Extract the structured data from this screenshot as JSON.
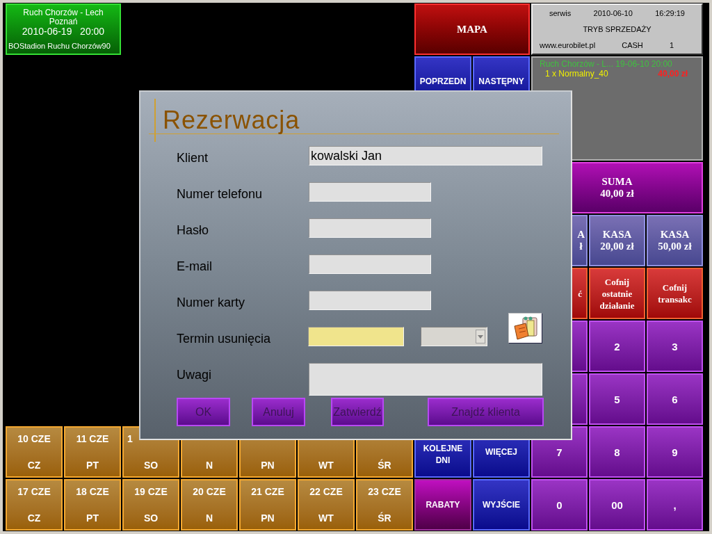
{
  "event_tile": {
    "title": "Ruch Chorzów - Lech Poznań",
    "datetime": "2010-06-19   20:00",
    "venue": "BOStadion Ruchu Chorzów",
    "count": "90"
  },
  "info_panel": {
    "user": "serwis",
    "date": "2010-06-10",
    "time": "16:29:19",
    "mode": "TRYB SPRZEDAŻY",
    "site": "www.eurobilet.pl",
    "payment": "CASH",
    "terminal": "1"
  },
  "cart": {
    "event": "Ruch Chorzów - L... 19-06-10 20:00",
    "items": [
      {
        "label": "1 x Normalny_40",
        "price": "40,00 zł"
      }
    ]
  },
  "buttons": [
    {
      "kind": "map",
      "lines": [
        "MAPA"
      ]
    },
    {
      "kind": "nav",
      "lines": [
        "POPRZEDN"
      ]
    },
    {
      "kind": "nav",
      "lines": [
        "NASTĘPNY"
      ]
    },
    {
      "kind": "total",
      "lines": [
        "SUMA",
        "40,00 zł"
      ]
    },
    {
      "kind": "cash",
      "lines": [
        "A",
        "ł"
      ]
    },
    {
      "kind": "cash",
      "lines": [
        "KASA",
        "20,00 zł"
      ]
    },
    {
      "kind": "cash",
      "lines": [
        "KASA",
        "50,00 zł"
      ]
    },
    {
      "kind": "undo",
      "lines": [
        "ć"
      ]
    },
    {
      "kind": "undo",
      "lines": [
        "Cofnij",
        "ostatnie",
        "działanie"
      ]
    },
    {
      "kind": "undo",
      "lines": [
        "Cofnij",
        "transakc"
      ]
    },
    {
      "kind": "key"
    },
    {
      "kind": "key",
      "lines": [
        "2"
      ]
    },
    {
      "kind": "key",
      "lines": [
        "3"
      ]
    },
    {
      "kind": "key"
    },
    {
      "kind": "key",
      "lines": [
        "5"
      ]
    },
    {
      "kind": "key",
      "lines": [
        "6"
      ]
    },
    {
      "kind": "nav",
      "lines": [
        "KOLEJNE",
        "DNI"
      ]
    },
    {
      "kind": "nav",
      "lines": [
        "WIĘCEJ"
      ]
    },
    {
      "kind": "key",
      "lines": [
        "7"
      ]
    },
    {
      "kind": "key",
      "lines": [
        "8"
      ]
    },
    {
      "kind": "key",
      "lines": [
        "9"
      ]
    },
    {
      "kind": "discount",
      "lines": [
        "RABATY"
      ]
    },
    {
      "kind": "nav",
      "lines": [
        "WYJŚCIE"
      ]
    },
    {
      "kind": "key",
      "lines": [
        "0"
      ]
    },
    {
      "kind": "key",
      "lines": [
        "00"
      ]
    },
    {
      "kind": "key",
      "lines": [
        ","
      ]
    }
  ],
  "calendar_days": [
    {
      "date": "10 CZE",
      "weekday": "CZ"
    },
    {
      "date": "11 CZE",
      "weekday": "PT"
    },
    {
      "date": "1",
      "weekday": "SO"
    },
    {
      "weekday": "N"
    },
    {
      "weekday": "PN"
    },
    {
      "weekday": "WT"
    },
    {
      "weekday": "ŚR"
    },
    {
      "date": "17 CZE",
      "weekday": "CZ"
    },
    {
      "date": "18 CZE",
      "weekday": "PT"
    },
    {
      "date": "19 CZE",
      "weekday": "SO"
    },
    {
      "date": "20 CZE",
      "weekday": "N"
    },
    {
      "date": "21 CZE",
      "weekday": "PN"
    },
    {
      "date": "22 CZE",
      "weekday": "WT"
    },
    {
      "date": "23 CZE",
      "weekday": "ŚR"
    }
  ],
  "dialog": {
    "title": "Rezerwacja",
    "fields": [
      {
        "label": "Klient",
        "kind": "wide",
        "value": "kowalski Jan"
      },
      {
        "label": "Numer telefonu",
        "kind": "short"
      },
      {
        "label": "Hasło",
        "kind": "short"
      },
      {
        "label": "E-mail",
        "kind": "short"
      },
      {
        "label": "Numer karty",
        "kind": "short"
      },
      {
        "label": "Termin usunięcia",
        "kind": "date"
      },
      {
        "label": "Uwagi",
        "kind": "memo"
      }
    ],
    "buttons": [
      "OK",
      "Anuluj",
      "Zatwierdź",
      "Znajdź klienta"
    ]
  }
}
